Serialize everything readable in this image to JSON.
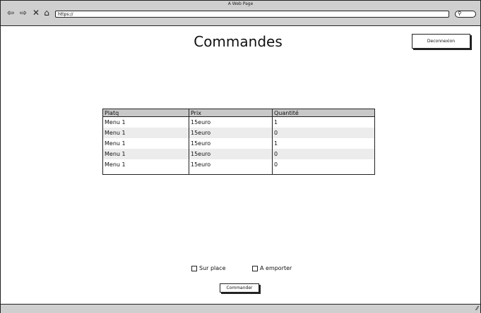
{
  "browser": {
    "window_title": "A Web Page",
    "url": "https://",
    "back_icon": "⇦",
    "forward_icon": "⇨",
    "stop_icon": "✕",
    "home_icon": "⌂",
    "search_icon": "⚲"
  },
  "header": {
    "title": "Commandes",
    "logout_label": "Deconnexion"
  },
  "orders": {
    "columns": [
      "Platq",
      "Prix",
      "Quantité"
    ],
    "rows": [
      [
        "Menu 1",
        "15euro",
        "1"
      ],
      [
        "Menu 1",
        "15euro",
        "0"
      ],
      [
        "Menu 1",
        "15euro",
        "1"
      ],
      [
        "Menu 1",
        "15euro",
        "0"
      ],
      [
        "Menu 1",
        "15euro",
        "0"
      ]
    ]
  },
  "options": {
    "dine_in_label": "Sur place",
    "takeaway_label": "A emporter"
  },
  "actions": {
    "order_label": "Commander"
  }
}
